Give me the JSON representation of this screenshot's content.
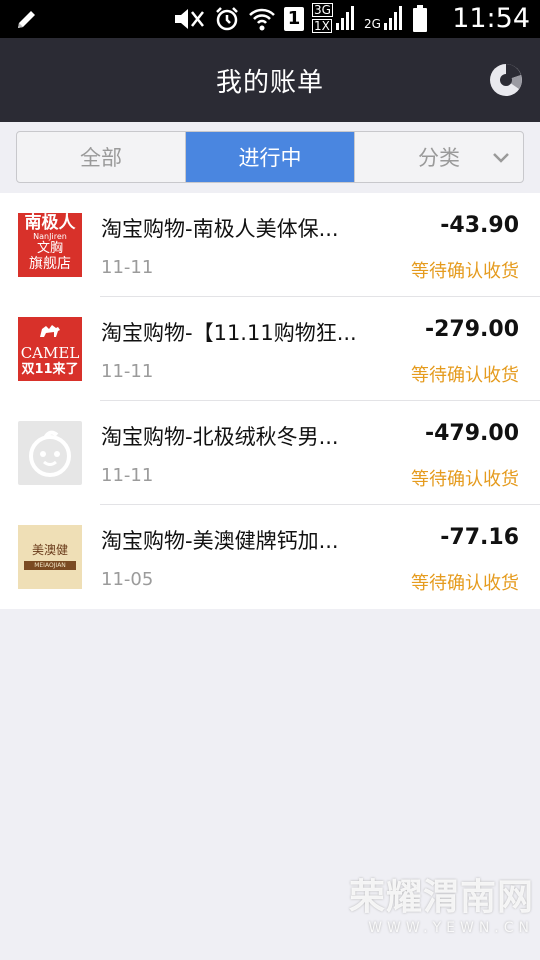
{
  "status_bar": {
    "time": "11:54",
    "signal_label_3g": "3G",
    "signal_label_1x": "1X",
    "signal_label_2g": "2G",
    "sim_slot": "1"
  },
  "header": {
    "title": "我的账单",
    "action_icon": "pie-chart-icon"
  },
  "tabs": [
    {
      "label": "全部",
      "active": false
    },
    {
      "label": "进行中",
      "active": true
    },
    {
      "label": "分类",
      "active": false
    }
  ],
  "bills": [
    {
      "title": "淘宝购物-南极人美体保...",
      "date": "11-11",
      "amount": "-43.90",
      "status": "等待确认收货",
      "thumb": {
        "line1": "南极人",
        "line2": "NanJiren",
        "line3": "文胸",
        "line4": "旗舰店"
      }
    },
    {
      "title": "淘宝购物-【11.11购物狂...",
      "date": "11-11",
      "amount": "-279.00",
      "status": "等待确认收货",
      "thumb": {
        "line1": "CAMEL",
        "line2": "双11来了"
      }
    },
    {
      "title": "淘宝购物-北极绒秋冬男...",
      "date": "11-11",
      "amount": "-479.00",
      "status": "等待确认收货",
      "thumb": {}
    },
    {
      "title": "淘宝购物-美澳健牌钙加...",
      "date": "11-05",
      "amount": "-77.16",
      "status": "等待确认收货",
      "thumb": {
        "line1": "美澳健",
        "line2": "MEIAOJIAN"
      }
    }
  ],
  "watermark": {
    "main": "荣耀渭南网",
    "sub": "WWW.YEWN.CN"
  },
  "colors": {
    "nav_bg": "#2b2b34",
    "tab_active": "#4a86e0",
    "status_orange": "#e59b1e",
    "thumb_red": "#d8312a"
  }
}
